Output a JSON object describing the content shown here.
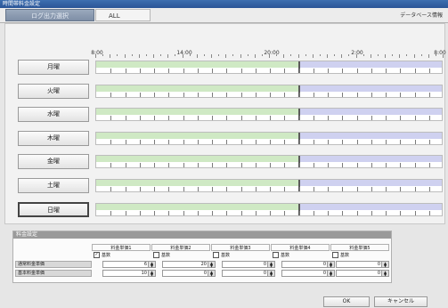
{
  "window": {
    "title": "時間帯料金設定"
  },
  "tabs": {
    "group_label": "ログ出力選択",
    "all_label": "ALL"
  },
  "header": {
    "db_label": "データベース情報"
  },
  "timeline": {
    "labels": [
      "8:00",
      "14:00",
      "20:00",
      "2:00",
      "8:00"
    ]
  },
  "days": [
    {
      "label": "月曜",
      "selected": false
    },
    {
      "label": "火曜",
      "selected": false
    },
    {
      "label": "水曜",
      "selected": false
    },
    {
      "label": "木曜",
      "selected": false
    },
    {
      "label": "金曜",
      "selected": false
    },
    {
      "label": "土曜",
      "selected": false
    },
    {
      "label": "日曜",
      "selected": true
    }
  ],
  "rates": {
    "title": "料金設定",
    "columns": [
      {
        "label": "料金単価1",
        "color": "#c9c9ee",
        "check": "基数",
        "checked": true
      },
      {
        "label": "料金単価2",
        "color": "#cde9c2",
        "check": "基数",
        "checked": false
      },
      {
        "label": "料金単価3",
        "color": "#f3f3a8",
        "check": "基数",
        "checked": false
      },
      {
        "label": "料金単価4",
        "color": "#f9dfc0",
        "check": "基数",
        "checked": false
      },
      {
        "label": "料金単価5",
        "color": "#f4c8ea",
        "check": "基数",
        "checked": false
      }
    ],
    "rows": [
      {
        "label": "通常料金単価",
        "values": [
          "6",
          "20",
          "0",
          "0",
          "0"
        ]
      },
      {
        "label": "基本料金単価",
        "values": [
          "10",
          "0",
          "0",
          "0",
          "0"
        ]
      }
    ]
  },
  "buttons": {
    "ok": "OK",
    "cancel": "キャンセル"
  },
  "colors": {
    "green_segment": "#cfe9c4",
    "blue_segment": "#cfd1f0",
    "title_bar": "#2a5597"
  }
}
